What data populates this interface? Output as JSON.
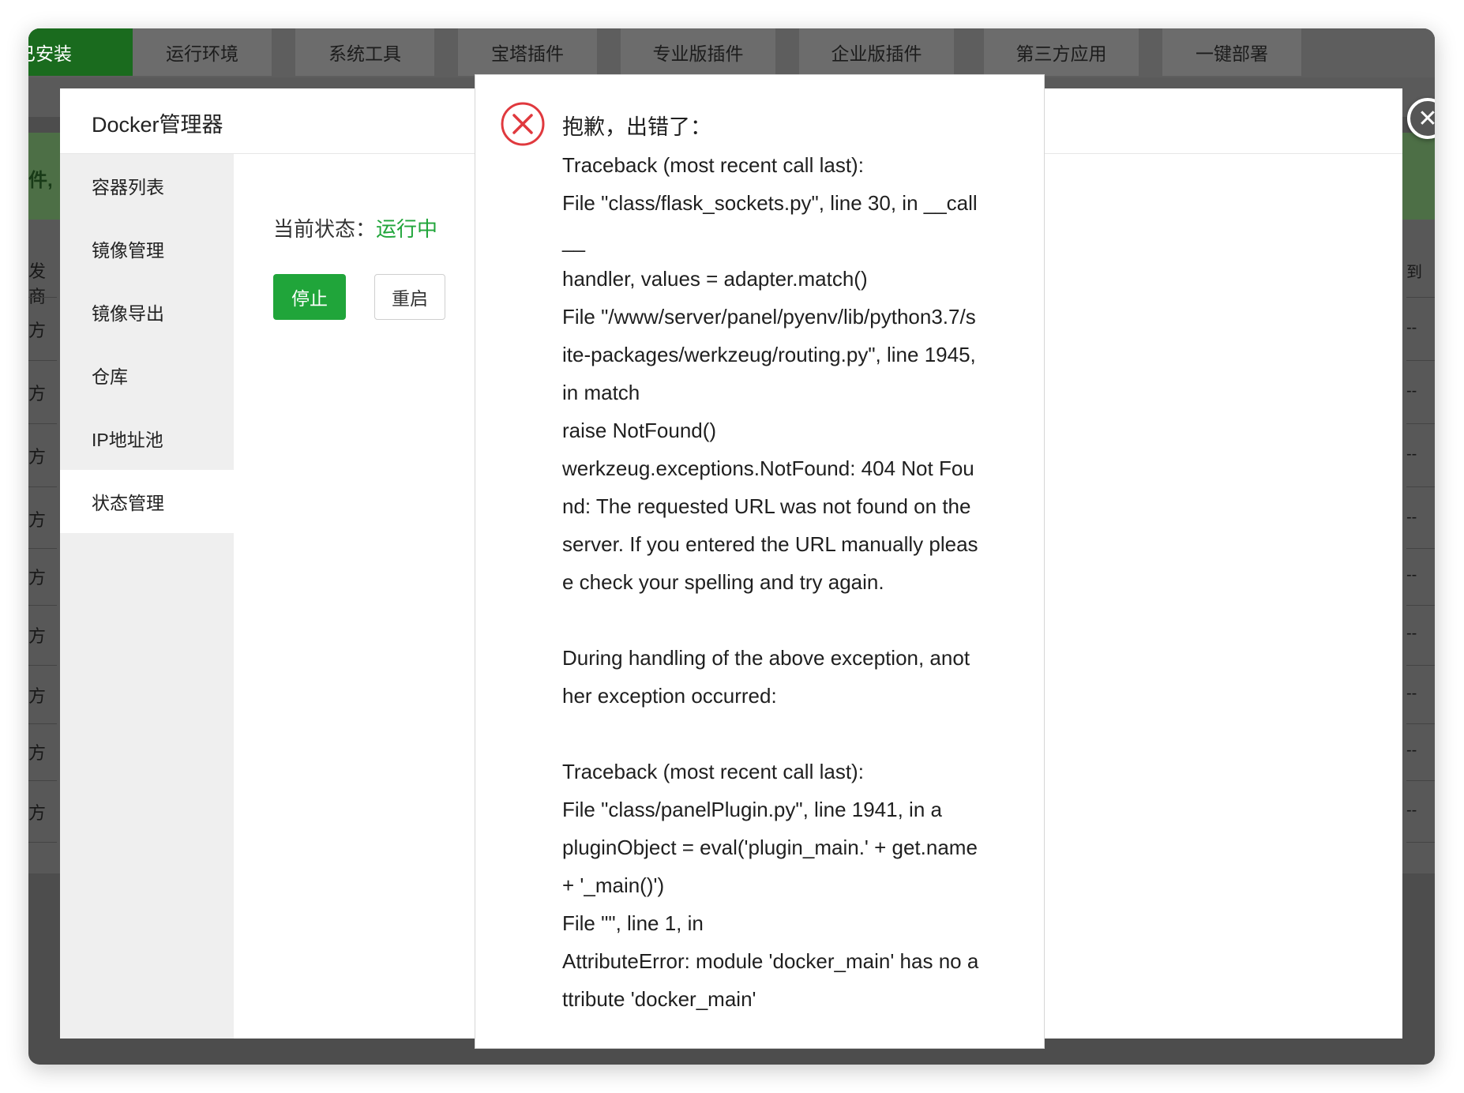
{
  "tabs": [
    {
      "label": "已安装"
    },
    {
      "label": "运行环境"
    },
    {
      "label": "系统工具"
    },
    {
      "label": "宝塔插件"
    },
    {
      "label": "专业版插件"
    },
    {
      "label": "企业版插件"
    },
    {
      "label": "第三方应用"
    },
    {
      "label": "一键部署"
    }
  ],
  "background": {
    "banner_fragment": "件,",
    "header_left": "发商",
    "header_right": "到",
    "row_left_text": "方",
    "row_right_text": "--"
  },
  "dialog": {
    "title": "Docker管理器",
    "sidebar": [
      {
        "label": "容器列表"
      },
      {
        "label": "镜像管理"
      },
      {
        "label": "镜像导出"
      },
      {
        "label": "仓库"
      },
      {
        "label": "IP地址池"
      },
      {
        "label": "状态管理"
      }
    ],
    "status_label": "当前状态：",
    "status_value": "运行中",
    "stop_button": "停止",
    "restart_button": "重启"
  },
  "close_button": "✕",
  "error": {
    "title": "抱歉，出错了：",
    "lines": [
      "Traceback (most recent call last):",
      "File \"class/flask_sockets.py\", line 30, in __call",
      "__",
      "handler, values = adapter.match()",
      "File \"/www/server/panel/pyenv/lib/python3.7/s",
      "ite-packages/werkzeug/routing.py\", line 1945,",
      "in match",
      "raise NotFound()",
      "werkzeug.exceptions.NotFound: 404 Not Fou",
      "nd: The requested URL was not found on the",
      "server. If you entered the URL manually pleas",
      "e check your spelling and try again.",
      "",
      "During handling of the above exception, anot",
      "her exception occurred:",
      "",
      "Traceback (most recent call last):",
      "File \"class/panelPlugin.py\", line 1941, in a",
      "pluginObject = eval('plugin_main.' + get.name",
      "+ '_main()')",
      "File \"\", line 1, in",
      "AttributeError: module 'docker_main' has no a",
      "ttribute 'docker_main'"
    ]
  },
  "colors": {
    "accent_green": "#20a53a",
    "error_red": "#e0393e"
  }
}
